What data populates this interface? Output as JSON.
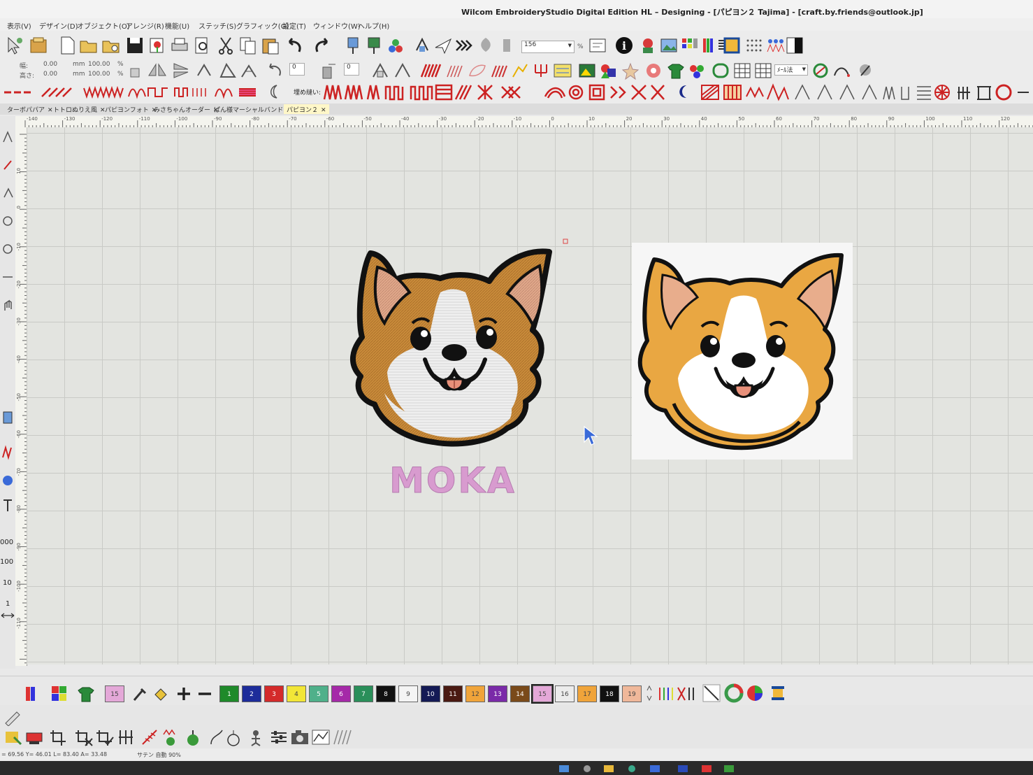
{
  "window": {
    "title": "Wilcom EmbroideryStudio Digital Edition HL – Designing - [パピヨン２     Tajima] - [craft.by.friends@outlook.jp]"
  },
  "menu": [
    "表示(V)",
    "デザイン(D)",
    "オブジェクト(O)",
    "アレンジ(R)",
    "機能(U)",
    "ステッチ(S)",
    "グラフィック(G)",
    "設定(T)",
    "ウィンドウ(W)",
    "ヘルプ(H)"
  ],
  "toolbar": {
    "zoom_value": "156",
    "zoom_unit": "%",
    "width_label": "幅:",
    "height_label": "高さ:",
    "width_value": "0.00",
    "height_value": "0.00",
    "unit_mm": "mm",
    "scale_w": "100.00",
    "scale_h": "100.00",
    "percent": "%",
    "angle_value": "0",
    "slant_value": "0",
    "fill_label": "埋め縫い:",
    "method_select": "ﾒｰﾙ法"
  },
  "tabs": [
    {
      "label": "ターボパパア",
      "active": false
    },
    {
      "label": "トトロぬりえ風",
      "active": false
    },
    {
      "label": "パピヨンフォト",
      "active": false
    },
    {
      "label": "みさちゃんオーダー",
      "active": false
    },
    {
      "label": "ぱん様マーシャルバンド",
      "active": false
    },
    {
      "label": "パピヨン２",
      "active": true
    }
  ],
  "ruler": {
    "labels": [
      "-140",
      "-130",
      "-120",
      "-110",
      "-100",
      "-90",
      "-80",
      "-70",
      "-60",
      "-50",
      "-40",
      "-30",
      "-20",
      "-10",
      "0",
      "10",
      "20",
      "30",
      "40",
      "50",
      "60",
      "70",
      "80",
      "90",
      "100",
      "110",
      "120"
    ],
    "vlabels": [
      "10",
      "0",
      "-10",
      "-20",
      "-30",
      "-40",
      "-50",
      "-60",
      "-70",
      "-80",
      "-90",
      "-100",
      "-110"
    ]
  },
  "left_readouts": [
    "000",
    "100",
    "10",
    "1"
  ],
  "design": {
    "name_text": "MOKA",
    "colors": {
      "fur": "#c98b3a",
      "ear_inner": "#e0a88a",
      "outline": "#111111",
      "white": "#f2f2f2",
      "tongue": "#e8907a",
      "text_pink": "#d89bcf"
    }
  },
  "palette": {
    "current": "15",
    "swatches": [
      {
        "label": "1",
        "color": "#1f8a2a"
      },
      {
        "label": "2",
        "color": "#1d2c9a"
      },
      {
        "label": "3",
        "color": "#d42a2a"
      },
      {
        "label": "4",
        "color": "#f2e637"
      },
      {
        "label": "5",
        "color": "#4fb08a"
      },
      {
        "label": "6",
        "color": "#a529a8"
      },
      {
        "label": "7",
        "color": "#2a8f5a"
      },
      {
        "label": "8",
        "color": "#111111"
      },
      {
        "label": "9",
        "color": "#f4f4f4"
      },
      {
        "label": "10",
        "color": "#141a55"
      },
      {
        "label": "11",
        "color": "#4a1a12"
      },
      {
        "label": "12",
        "color": "#f0a43a"
      },
      {
        "label": "13",
        "color": "#7a2aa8"
      },
      {
        "label": "14",
        "color": "#7a4a1a"
      },
      {
        "label": "15",
        "color": "#e4a8d8"
      },
      {
        "label": "16",
        "color": "#ececec"
      },
      {
        "label": "17",
        "color": "#f0a43a"
      },
      {
        "label": "18",
        "color": "#111111"
      },
      {
        "label": "19",
        "color": "#f0b89a"
      }
    ]
  },
  "status": {
    "coords": "= 69.56 Y= 46.01 L= 83.40 A= 33.48",
    "mode": "サテン 自動 90%"
  }
}
